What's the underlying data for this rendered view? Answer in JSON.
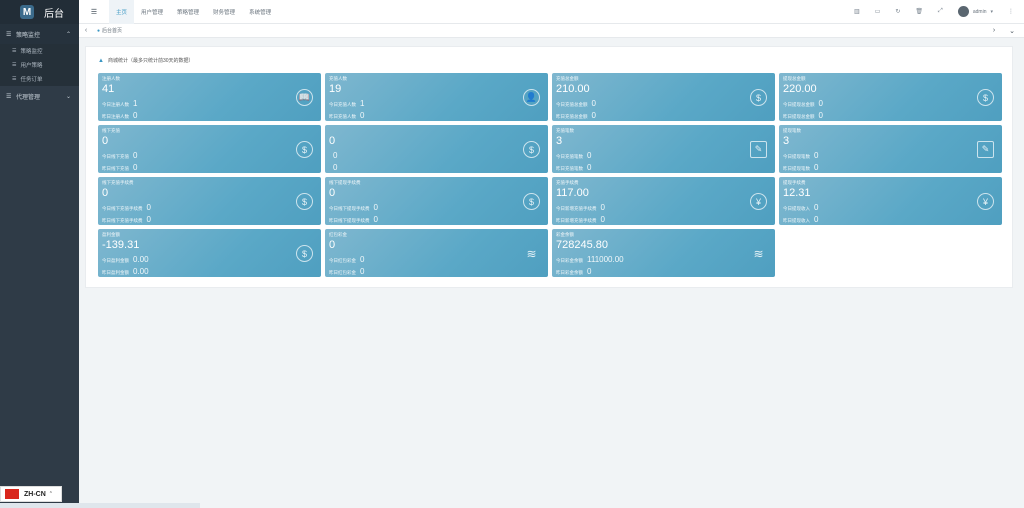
{
  "brand": {
    "title": "后台"
  },
  "sidebar": {
    "groups": [
      {
        "label": "策略监控",
        "open": true
      },
      {
        "label": "代理管理",
        "open": false
      }
    ],
    "subitems": [
      "策略监控",
      "用户策略",
      "任务订单"
    ]
  },
  "topbar": {
    "tabs": [
      "主页",
      "用户管理",
      "策略管理",
      "财务管理",
      "系统管理"
    ],
    "user": "admin"
  },
  "breadcrumb": {
    "label": "后台首页"
  },
  "panel": {
    "title": "商城统计（最多只统计前30天的数据）"
  },
  "cards": [
    {
      "label": "注册人数",
      "value": "41",
      "row1_label": "今日注册人数",
      "row1_value": "1",
      "row2_label": "昨日注册人数",
      "row2_value": "0",
      "icon": "book-icon"
    },
    {
      "label": "充值人数",
      "value": "19",
      "row1_label": "今日充值人数",
      "row1_value": "1",
      "row2_label": "昨日充值人数",
      "row2_value": "0",
      "icon": "user-icon"
    },
    {
      "label": "充值总金额",
      "value": "210.00",
      "row1_label": "今日充值总金额",
      "row1_value": "0",
      "row2_label": "昨日充值总金额",
      "row2_value": "0",
      "icon": "dollar-icon"
    },
    {
      "label": "提现总金额",
      "value": "220.00",
      "row1_label": "今日提现总金额",
      "row1_value": "0",
      "row2_label": "昨日提现总金额",
      "row2_value": "0",
      "icon": "dollar-icon"
    },
    {
      "label": "线下充值",
      "value": "0",
      "row1_label": "今日线下充值",
      "row1_value": "0",
      "row2_label": "昨日线下充值",
      "row2_value": "0",
      "icon": "dollar-icon"
    },
    {
      "label": "",
      "value": "0",
      "row1_label": "",
      "row1_value": "0",
      "row2_label": "",
      "row2_value": "0",
      "icon": "dollar-icon"
    },
    {
      "label": "充值笔数",
      "value": "3",
      "row1_label": "今日充值笔数",
      "row1_value": "0",
      "row2_label": "昨日充值笔数",
      "row2_value": "0",
      "icon": "edit-icon"
    },
    {
      "label": "提现笔数",
      "value": "3",
      "row1_label": "今日提现笔数",
      "row1_value": "0",
      "row2_label": "昨日提现笔数",
      "row2_value": "0",
      "icon": "edit-icon"
    },
    {
      "label": "线下充值手续费",
      "value": "0",
      "row1_label": "今日线下充值手续费",
      "row1_value": "0",
      "row2_label": "昨日线下充值手续费",
      "row2_value": "0",
      "icon": "dollar-icon"
    },
    {
      "label": "线下提现手续费",
      "value": "0",
      "row1_label": "今日线下提现手续费",
      "row1_value": "0",
      "row2_label": "昨日线下提现手续费",
      "row2_value": "0",
      "icon": "dollar-icon"
    },
    {
      "label": "充值手续费",
      "value": "117.00",
      "row1_label": "今日新增充值手续费",
      "row1_value": "0",
      "row2_label": "昨日新增充值手续费",
      "row2_value": "0",
      "icon": "yen-icon"
    },
    {
      "label": "提现手续费",
      "value": "12.31",
      "row1_label": "今日提现收入",
      "row1_value": "0",
      "row2_label": "昨日提现收入",
      "row2_value": "0",
      "icon": "yen-icon"
    },
    {
      "label": "盈利金额",
      "value": "-139.31",
      "row1_label": "今日盈利金额",
      "row1_value": "0.00",
      "row2_label": "昨日盈利金额",
      "row2_value": "0.00",
      "icon": "dollar-icon"
    },
    {
      "label": "红包彩金",
      "value": "0",
      "row1_label": "今日红包彩金",
      "row1_value": "0",
      "row2_label": "昨日红包彩金",
      "row2_value": "0",
      "icon": "stack-icon"
    },
    {
      "label": "彩金余额",
      "value": "728245.80",
      "row1_label": "今日彩金余额",
      "row1_value": "111000.00",
      "row2_label": "昨日彩金余额",
      "row2_value": "0",
      "icon": "stack-icon"
    }
  ],
  "language": {
    "label": "ZH-CN"
  }
}
